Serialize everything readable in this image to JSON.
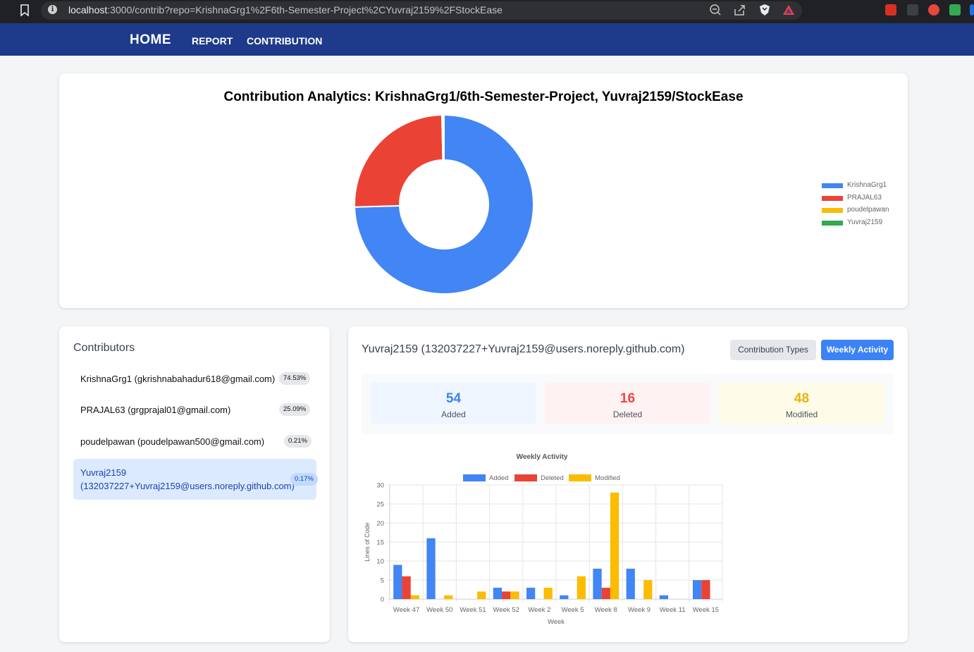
{
  "browser": {
    "url_host": "localhost",
    "url_rest": ":3000/contrib?repo=KrishnaGrg1%2F6th-Semester-Project%2CYuvraj2159%2FStockEase"
  },
  "nav": {
    "home": "HOME",
    "report": "REPORT",
    "contribution": "CONTRIBUTION"
  },
  "overview": {
    "title": "Contribution Analytics: KrishnaGrg1/6th-Semester-Project, Yuvraj2159/StockEase"
  },
  "colors": {
    "blue": "#4285f4",
    "red": "#ea4335",
    "yellow": "#fbbc04",
    "green": "#34a853"
  },
  "chart_data": [
    {
      "type": "pie",
      "variant": "doughnut",
      "labels": [
        "KrishnaGrg1",
        "PRAJAL63",
        "poudelpawan",
        "Yuvraj2159"
      ],
      "values": [
        74.53,
        25.09,
        0.21,
        0.17
      ],
      "colors": [
        "#4285f4",
        "#ea4335",
        "#fbbc04",
        "#34a853"
      ],
      "legend": "right"
    },
    {
      "type": "bar",
      "title": "Weekly Activity",
      "xlabel": "Week",
      "ylabel": "Lines of Code",
      "categories": [
        "Week 47",
        "Week 50",
        "Week 51",
        "Week 52",
        "Week 2",
        "Week 5",
        "Week 8",
        "Week 9",
        "Week 11",
        "Week 15"
      ],
      "series": [
        {
          "name": "Added",
          "color": "#4285f4",
          "values": [
            9,
            16,
            0,
            3,
            3,
            1,
            8,
            8,
            1,
            5
          ]
        },
        {
          "name": "Deleted",
          "color": "#ea4335",
          "values": [
            6,
            0,
            0,
            2,
            0,
            0,
            3,
            0,
            0,
            5
          ]
        },
        {
          "name": "Modified",
          "color": "#fbbc04",
          "values": [
            1,
            1,
            2,
            2,
            3,
            6,
            28,
            5,
            0,
            0
          ]
        }
      ],
      "ylim": [
        0,
        30
      ],
      "yticks": [
        0,
        5,
        10,
        15,
        20,
        25,
        30
      ],
      "grid": true,
      "legend": "top"
    }
  ],
  "contributors": {
    "title": "Contributors",
    "items": [
      {
        "name": "KrishnaGrg1 (gkrishnabahadur618@gmail.com)",
        "pct": "74.53%"
      },
      {
        "name": "PRAJAL63 (grgprajal01@gmail.com)",
        "pct": "25.09%"
      },
      {
        "name": "poudelpawan (poudelpawan500@gmail.com)",
        "pct": "0.21%"
      },
      {
        "name_line1": "Yuvraj2159",
        "name_line2": "(132037227+Yuvraj2159@users.noreply.github.com)",
        "pct": "0.17%",
        "selected": true
      }
    ]
  },
  "detail": {
    "title": "Yuvraj2159 (132037227+Yuvraj2159@users.noreply.github.com)",
    "btn_types": "Contribution Types",
    "btn_weekly": "Weekly Activity",
    "stats": {
      "added": {
        "value": "54",
        "label": "Added"
      },
      "deleted": {
        "value": "16",
        "label": "Deleted"
      },
      "modified": {
        "value": "48",
        "label": "Modified"
      }
    }
  }
}
